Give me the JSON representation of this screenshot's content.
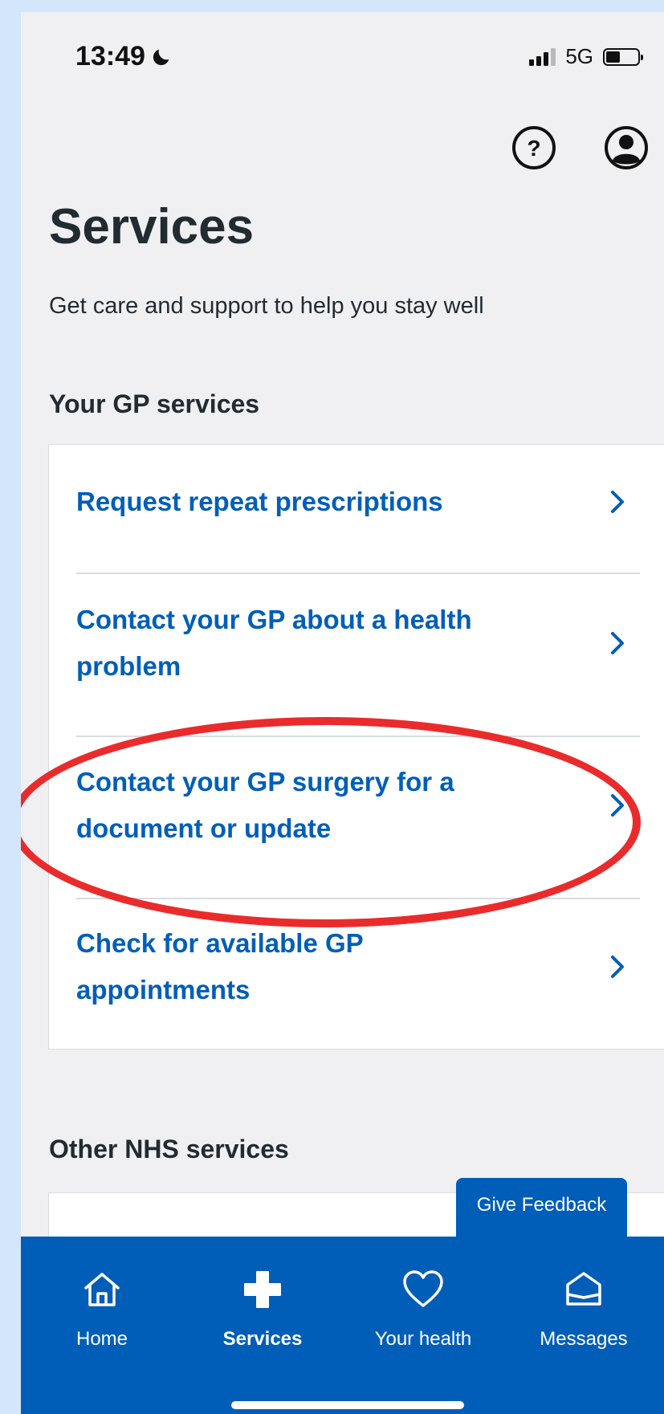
{
  "status_bar": {
    "time": "13:49",
    "network": "5G",
    "battery_level": 0.45
  },
  "header": {
    "title": "Services",
    "subtitle": "Get care and support to help you stay well"
  },
  "gp_section": {
    "heading": "Your GP services",
    "items": [
      {
        "label": "Request repeat prescriptions"
      },
      {
        "label": "Contact your GP about a health problem"
      },
      {
        "label": "Contact your GP surgery for a document or update"
      },
      {
        "label": "Check for available GP appointments"
      }
    ]
  },
  "other_section": {
    "heading": "Other NHS services"
  },
  "feedback": {
    "label": "Give Feedback"
  },
  "nav": {
    "items": [
      {
        "label": "Home",
        "icon": "home-icon"
      },
      {
        "label": "Services",
        "icon": "plus-icon",
        "active": true
      },
      {
        "label": "Your health",
        "icon": "heart-icon"
      },
      {
        "label": "Messages",
        "icon": "envelope-icon"
      }
    ]
  },
  "colors": {
    "nhs_blue": "#005eb8",
    "background": "#f0f0f3",
    "annotation": "#ea2b2b"
  }
}
